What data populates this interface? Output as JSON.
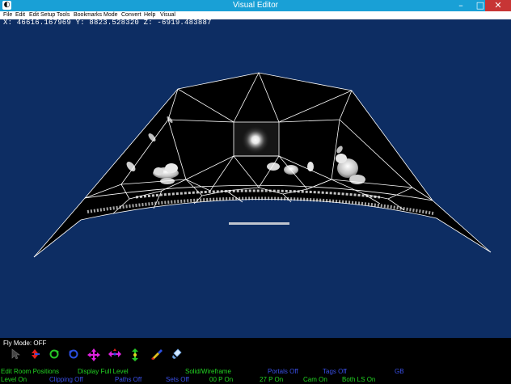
{
  "window": {
    "title": "Visual Editor",
    "minimize_glyph": "–",
    "maximize_glyph": "□",
    "close_glyph": "✕",
    "app_glyph": "◐"
  },
  "menu": [
    {
      "label": "File"
    },
    {
      "label": "Edit"
    },
    {
      "label": "Edit Setup"
    },
    {
      "label": "Tools"
    },
    {
      "label": "Bookmarks"
    },
    {
      "label": "Mode"
    },
    {
      "label": "Convert"
    },
    {
      "label": "Help"
    },
    {
      "label": "Visual"
    }
  ],
  "coords": "X: 46616.167969 Y: 8823.528320 Z: -6919.483887",
  "fly_mode": "Fly Mode: OFF",
  "toolbar": [
    {
      "name": "select-cursor-icon"
    },
    {
      "name": "move-updown-icon"
    },
    {
      "name": "rotate-green-icon"
    },
    {
      "name": "rotate-blue-icon"
    },
    {
      "name": "move-4way-icon"
    },
    {
      "name": "move-horizontal-icon"
    },
    {
      "name": "move-vertical-icon"
    },
    {
      "name": "paint-brush-icon"
    },
    {
      "name": "paint-bucket-icon"
    }
  ],
  "status_row1": [
    {
      "text": "Edit Room Positions",
      "color": "#22d322"
    },
    {
      "text": "Display Full Level",
      "color": "#22d322"
    },
    {
      "text": "Solid/Wireframe",
      "color": "#22d322"
    },
    {
      "text": "Portals Off",
      "color": "#3a4fe8"
    },
    {
      "text": "Tags Off",
      "color": "#3a4fe8"
    },
    {
      "text": "GB",
      "color": "#3a4fe8"
    }
  ],
  "status_row2": [
    {
      "text": "Level On",
      "color": "#22d322"
    },
    {
      "text": "Clipping Off",
      "color": "#3a4fe8"
    },
    {
      "text": "Paths Off",
      "color": "#3a4fe8"
    },
    {
      "text": "Sets Off",
      "color": "#3a4fe8"
    },
    {
      "text": "00 P On",
      "color": "#22d322"
    },
    {
      "text": "27 P On",
      "color": "#22d322"
    },
    {
      "text": "Cam On",
      "color": "#22d322"
    },
    {
      "text": "Both LS On",
      "color": "#22d322"
    }
  ]
}
